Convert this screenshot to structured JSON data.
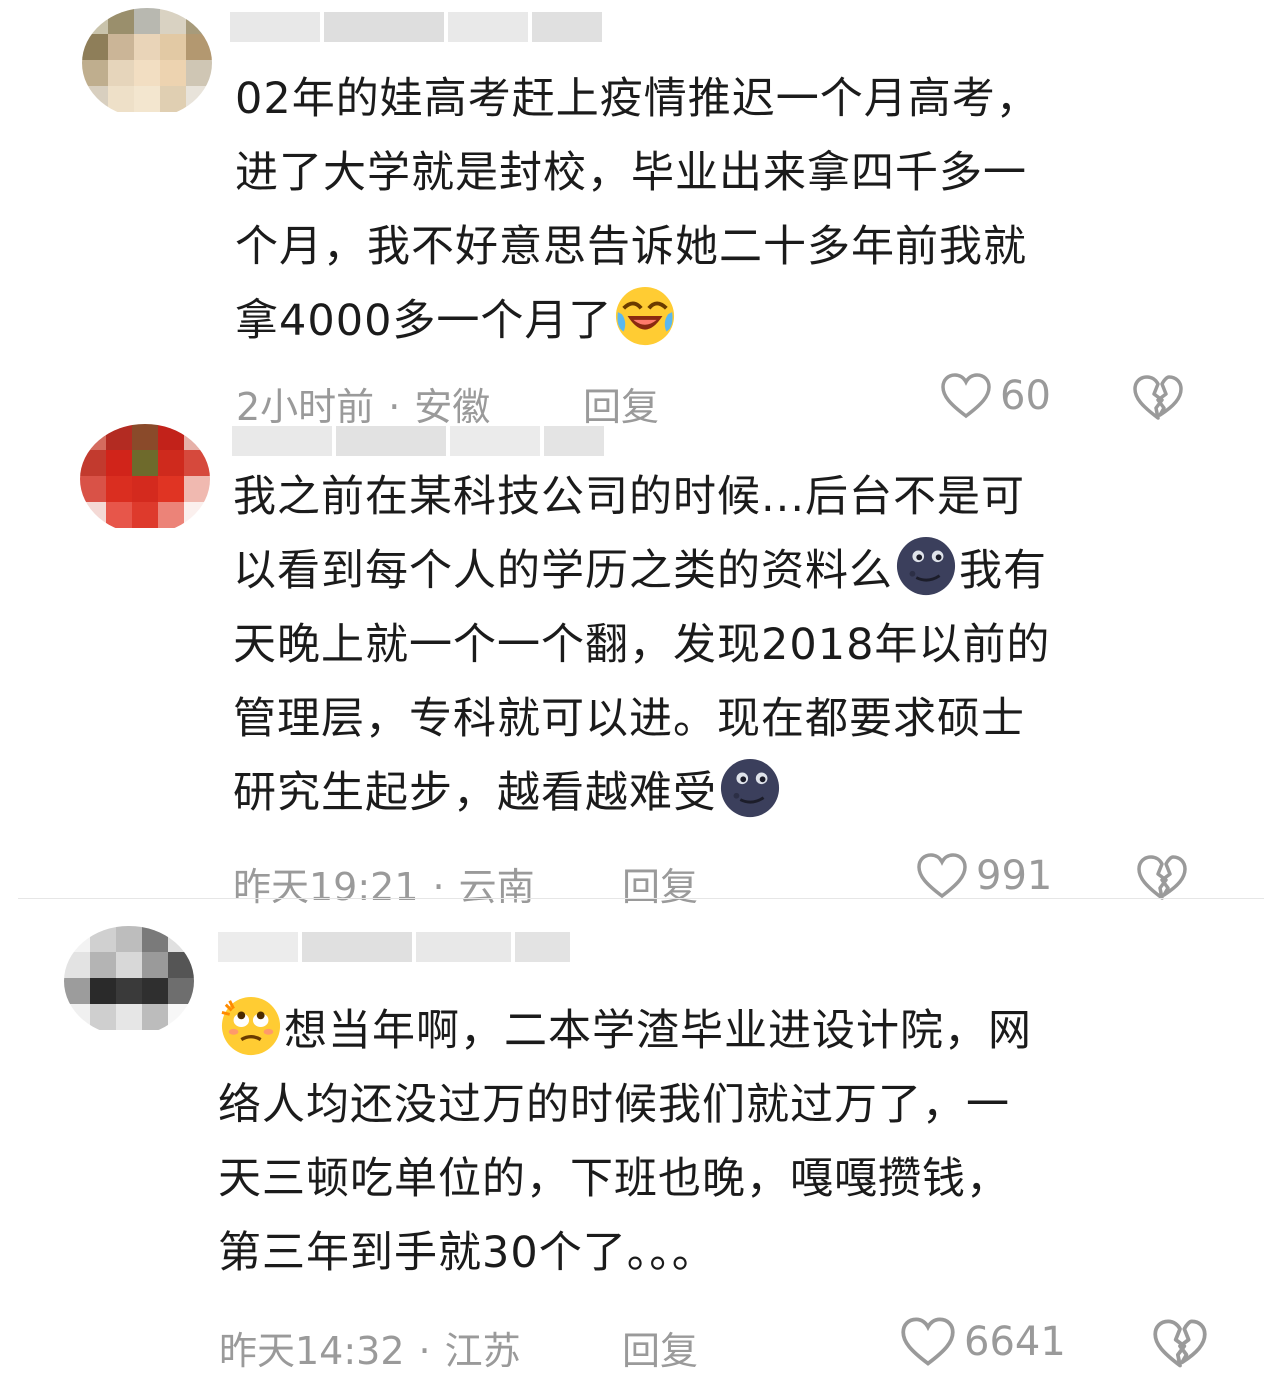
{
  "comments": [
    {
      "lines": [
        "02年的娃高考赶上疫情推迟一个月高考，",
        "进了大学就是封校，毕业出来拿四千多一",
        "个月，我不好意思告诉她二十多年前我就",
        "拿4000多一个月了"
      ],
      "end_emoji": "laughing-crying-emoji",
      "time": "2小时前",
      "location": "安徽",
      "reply_label": "回复",
      "likes": "60"
    },
    {
      "lines": [
        "我之前在某科技公司的时候...后台不是可",
        "以看到每个人的学历之类的资料么",
        "天晚上就一个一个翻，发现2018年以前的",
        "管理层，专科就可以进。现在都要求硕士",
        "研究生起步，越看越难受"
      ],
      "line2_suffix": "我有",
      "mid_emoji": "new-moon-face-emoji",
      "end_emoji": "new-moon-face-emoji",
      "time": "昨天19:21",
      "location": "云南",
      "reply_label": "回复",
      "likes": "991"
    },
    {
      "lines": [
        "想当年啊，二本学渣毕业进设计院，网",
        "络人均还没过万的时候我们就过万了，一",
        "天三顿吃单位的，下班也晚，嘎嘎攒钱，",
        "第三年到手就30个了。。。"
      ],
      "start_emoji": "face-with-rolling-eyes-emoji",
      "time": "昨天14:32",
      "location": "江苏",
      "reply_label": "回复",
      "likes": "6641"
    }
  ],
  "colors": {
    "text": "#1b1b1b",
    "meta": "#9a9a9a"
  }
}
